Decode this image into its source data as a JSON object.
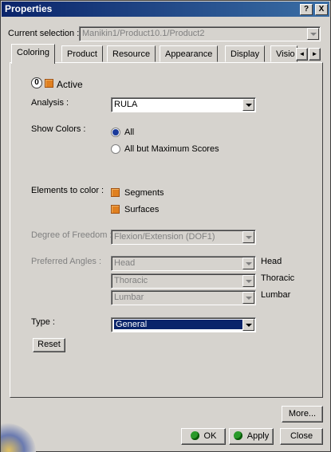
{
  "window": {
    "title": "Properties",
    "help_btn": "?",
    "close_btn": "X"
  },
  "current_selection": {
    "label": "Current selection :",
    "value": "Manikin1/Product10.1/Product2"
  },
  "tabs": [
    {
      "label": "Coloring"
    },
    {
      "label": "Product"
    },
    {
      "label": "Resource"
    },
    {
      "label": "Appearance"
    },
    {
      "label": "Display"
    },
    {
      "label": "Visio"
    }
  ],
  "tab_scroll": {
    "left": "◄",
    "right": "►"
  },
  "coloring": {
    "active_label": "Active",
    "analysis": {
      "label": "Analysis :",
      "value": "RULA"
    },
    "show_colors": {
      "label": "Show Colors :",
      "option_all": "All",
      "option_all_but": "All but Maximum Scores",
      "selected": "All"
    },
    "elements": {
      "label": "Elements to color :",
      "segments": "Segments",
      "surfaces": "Surfaces"
    },
    "dof": {
      "label": "Degree of Freedom :",
      "value": "Flexion/Extension (DOF1)"
    },
    "preferred_angles": {
      "label": "Preferred Angles :",
      "rows": [
        {
          "value": "Head",
          "side_label": "Head"
        },
        {
          "value": "Thoracic",
          "side_label": "Thoracic"
        },
        {
          "value": "Lumbar",
          "side_label": "Lumbar"
        }
      ]
    },
    "type": {
      "label": "Type :",
      "value": "General"
    },
    "reset_label": "Reset"
  },
  "footer": {
    "more_label": "More...",
    "ok_label": "OK",
    "apply_label": "Apply",
    "close_label": "Close"
  },
  "colors": {
    "accent": "#0a246a",
    "checkbox": "#e08020",
    "ok_dot": "#2a9a2a"
  }
}
